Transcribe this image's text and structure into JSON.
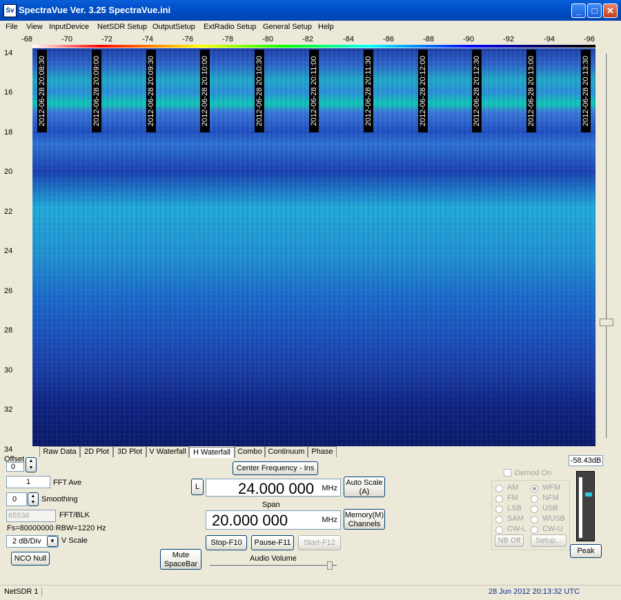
{
  "window": {
    "icon_text": "Sv",
    "title": "SpectraVue Ver. 3.25  SpectraVue.ini",
    "minimize": "_",
    "maximize": "□",
    "close": "✕"
  },
  "menu": [
    "File",
    "View",
    "InputDevice",
    "NetSDR Setup",
    "OutputSetup",
    "ExtRadio Setup",
    "General Setup",
    "Help"
  ],
  "freq_scale": [
    "-68",
    "-70",
    "-72",
    "-74",
    "-76",
    "-78",
    "-80",
    "-82",
    "-84",
    "-86",
    "-88",
    "-90",
    "-92",
    "-94",
    "-96"
  ],
  "y_scale": [
    "14",
    "16",
    "18",
    "20",
    "22",
    "24",
    "26",
    "28",
    "30",
    "32",
    "34"
  ],
  "timestamps": [
    "2012-06-28 20:08:30",
    "2012-06-28 20:09:00",
    "2012-06-28 20:09:30",
    "2012-06-28 20:10:00",
    "2012-06-28 20:10:30",
    "2012-06-28 20:11:00",
    "2012-06-28 20:11:30",
    "2012-06-28 20:12:00",
    "2012-06-28 20:12:30",
    "2012-06-28 20:13:00",
    "2012-06-28 20:13:30"
  ],
  "tabs": [
    "Raw Data",
    "2D Plot",
    "3D Plot",
    "V Waterfall",
    "H Waterfall",
    "Combo",
    "Continuum",
    "Phase"
  ],
  "active_tab": "H Waterfall",
  "controls": {
    "offset_label": "Offset",
    "offset_value": "0",
    "fft_ave_value": "1",
    "fft_ave_label": "FFT Ave",
    "smoothing_value": "0",
    "smoothing_label": "Smoothing",
    "fft_blk_value": "65536",
    "fft_blk_label": "FFT/BLK",
    "fs_info": "Fs=80000000 RBW=1220 Hz",
    "vscale_value": "2 dB/Div",
    "vscale_label": "V Scale",
    "nco_null": "NCO Null",
    "mute": "Mute SpaceBar",
    "center_freq_button": "Center Frequency - Ins",
    "l_button": "L",
    "center_freq_value": "24.000 000",
    "mhz": "MHz",
    "span_label": "Span",
    "span_value": "20.000 000",
    "auto_scale": "Auto Scale (A)",
    "memory": "Memory(M) Channels",
    "stop": "Stop-F10",
    "pause": "Pause-F11",
    "start": "Start-F12",
    "audio_volume": "Audio Volume",
    "demod_on": "Demod On",
    "modes_left": [
      "AM",
      "FM",
      "LSB",
      "SAM",
      "CW-L"
    ],
    "modes_right": [
      "WFM",
      "NFM",
      "USB",
      "WUSB",
      "CW-U"
    ],
    "selected_mode": "WFM",
    "nb_off": "NB Off",
    "setup": "Setup...",
    "level_readout": "-58.43dB",
    "peak": "Peak"
  },
  "status": {
    "device": "NetSDR 1",
    "datetime": "28 Jun 2012  20:13:32 UTC"
  },
  "colors": {
    "titlebar": "#0050c8",
    "face": "#ece9d8"
  }
}
